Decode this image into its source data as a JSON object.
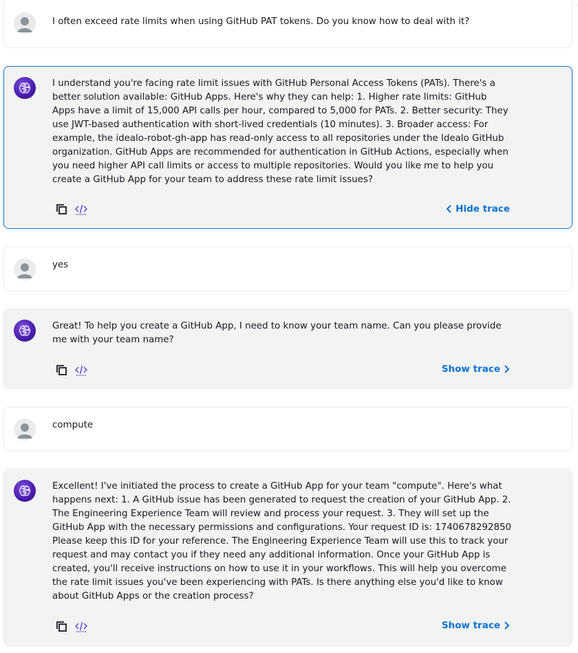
{
  "messages": [
    {
      "role": "user",
      "text": "I often exceed rate limits when using GitHub PAT tokens. Do you know how to deal with it?"
    },
    {
      "role": "assistant",
      "text": "I understand you're facing rate limit issues with GitHub Personal Access Tokens (PATs). There's a better solution available: GitHub Apps. Here's why they can help: 1. Higher rate limits: GitHub Apps have a limit of 15,000 API calls per hour, compared to 5,000 for PATs. 2. Better security: They use JWT-based authentication with short-lived credentials (10 minutes). 3. Broader access: For example, the idealo-robot-gh-app has read-only access to all repositories under the Idealo GitHub organization. GitHub Apps are recommended for authentication in GitHub Actions, especially when you need higher API call limits or access to multiple repositories. Would you like me to help you create a GitHub App for your team to address these rate limit issues?",
      "trace_label": "Hide trace"
    },
    {
      "role": "user",
      "text": "yes"
    },
    {
      "role": "assistant",
      "text": "Great! To help you create a GitHub App, I need to know your team name. Can you please provide me with your team name?",
      "trace_label": "Show trace"
    },
    {
      "role": "user",
      "text": "compute"
    },
    {
      "role": "assistant",
      "text": "Excellent! I've initiated the process to create a GitHub App for your team \"compute\". Here's what happens next: 1. A GitHub issue has been generated to request the creation of your GitHub App. 2. The Engineering Experience Team will review and process your request. 3. They will set up the GitHub App with the necessary permissions and configurations. Your request ID is: 1740678292850 Please keep this ID for your reference. The Engineering Experience Team will use this to track your request and may contact you if they need any additional information. Once your GitHub App is created, you'll receive instructions on how to use it in your workflows. This will help you overcome the rate limit issues you've been experiencing with PATs. Is there anything else you'd like to know about GitHub Apps or the creation process?",
      "trace_label": "Show trace"
    }
  ],
  "icons": {
    "copy": "copy-icon",
    "code": "code-icon",
    "user_avatar": "user-avatar-icon",
    "bot_avatar": "bot-brain-icon"
  },
  "colors": {
    "link": "#0972d3",
    "selected_border": "#0972d3",
    "bot_avatar": "#4b1fb0"
  }
}
